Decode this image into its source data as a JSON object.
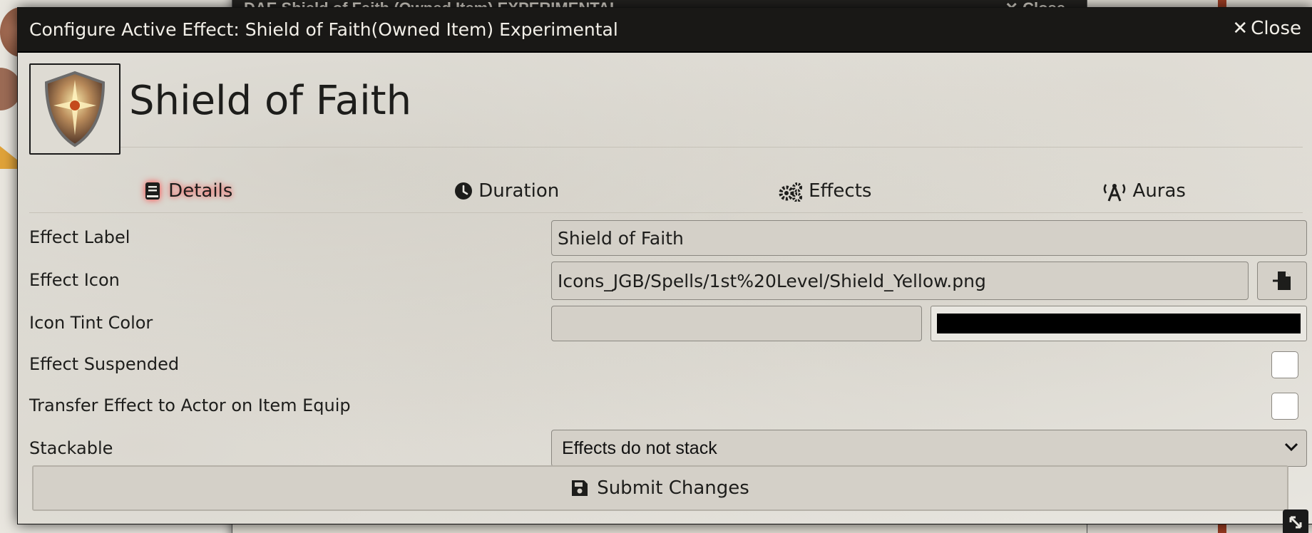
{
  "background_window": {
    "title": "DAE Shield of Faith (Owned Item) EXPERIMENTAL",
    "close_label": "Close"
  },
  "dialog": {
    "title": "Configure Active Effect: Shield of Faith(Owned Item) Experimental",
    "close_label": "Close",
    "effect_name": "Shield of Faith",
    "effect_image_icon": "shield-icon"
  },
  "tabs": [
    {
      "label": "Details",
      "icon": "book-icon",
      "active": true
    },
    {
      "label": "Duration",
      "icon": "clock-icon",
      "active": false
    },
    {
      "label": "Effects",
      "icon": "gears-icon",
      "active": false
    },
    {
      "label": "Auras",
      "icon": "broadcast-icon",
      "active": false
    }
  ],
  "form": {
    "effect_label": {
      "label": "Effect Label",
      "value": "Shield of Faith"
    },
    "effect_icon": {
      "label": "Effect Icon",
      "value": "Icons_JGB/Spells/1st%20Level/Shield_Yellow.png",
      "button_icon": "file-import-icon"
    },
    "icon_tint": {
      "label": "Icon Tint Color",
      "value": "",
      "color": "#000000"
    },
    "effect_suspended": {
      "label": "Effect Suspended",
      "checked": false
    },
    "transfer_effect": {
      "label": "Transfer Effect to Actor on Item Equip",
      "checked": false
    },
    "stackable": {
      "label": "Stackable",
      "selected": "Effects do not stack"
    }
  },
  "submit": {
    "label": "Submit Changes",
    "icon": "save-icon"
  },
  "colors": {
    "header_bg": "#191816",
    "panel_bg": "#e9e7e1",
    "field_bg": "#d4d0c8",
    "active_glow": "#ff3b3b"
  }
}
